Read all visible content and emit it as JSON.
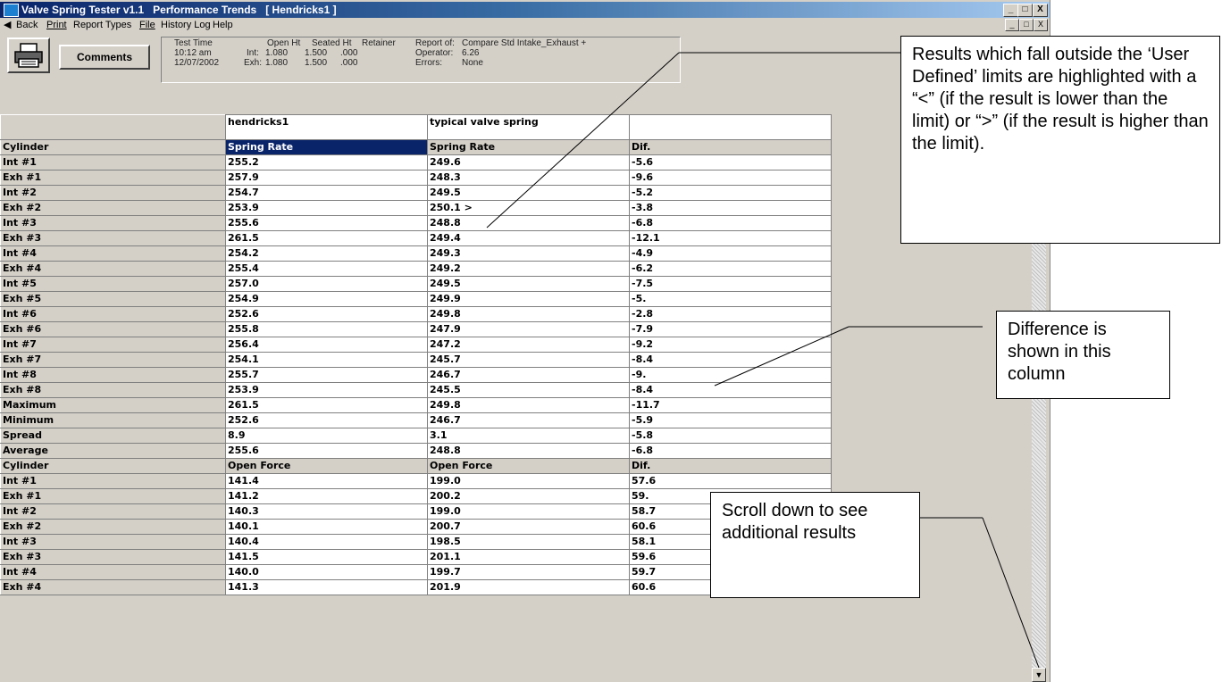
{
  "window": {
    "title": "Valve Spring Tester v1.1   Performance Trends   [ Hendricks1 ]",
    "min": "_",
    "max": "□",
    "close": "X"
  },
  "menu": {
    "back": "Back",
    "print": "Print",
    "report_types": "Report Types",
    "file": "File",
    "history_log": "History Log",
    "help": "Help"
  },
  "toolbar": {
    "comments": "Comments"
  },
  "info": {
    "test_time_label": "Test Time",
    "test_time": "10:12 am",
    "test_date": "12/07/2002",
    "int_label": "Int:",
    "exh_label": "Exh:",
    "open_ht_label": "Open Ht",
    "seated_ht_label": "Seated Ht",
    "retainer_label": "Retainer",
    "int_open": "1.080",
    "int_seated": "1.500",
    "int_retainer": ".000",
    "exh_open": "1.080",
    "exh_seated": "1.500",
    "exh_retainer": ".000",
    "report_of_label": "Report of:",
    "report_of": "Compare Std Intake_Exhaust +",
    "operator_label": "Operator:",
    "operator": "6.26",
    "errors_label": "Errors:",
    "errors": "None"
  },
  "grid": {
    "col_files": [
      "",
      "hendricks1",
      "typical valve spring",
      ""
    ],
    "rows": [
      [
        "Cylinder",
        "Spring Rate",
        "Spring Rate",
        "Dif."
      ],
      [
        "Int #1",
        "255.2",
        "249.6",
        "-5.6"
      ],
      [
        "Exh #1",
        "257.9",
        "248.3",
        "-9.6"
      ],
      [
        "Int #2",
        "254.7",
        "249.5",
        "-5.2"
      ],
      [
        "Exh #2",
        "253.9",
        "250.1 >",
        "-3.8"
      ],
      [
        "Int #3",
        "255.6",
        "248.8",
        "-6.8"
      ],
      [
        "Exh #3",
        "261.5",
        "249.4",
        "-12.1"
      ],
      [
        "Int #4",
        "254.2",
        "249.3",
        "-4.9"
      ],
      [
        "Exh #4",
        "255.4",
        "249.2",
        "-6.2"
      ],
      [
        "Int #5",
        "257.0",
        "249.5",
        "-7.5"
      ],
      [
        "Exh #5",
        "254.9",
        "249.9",
        "-5."
      ],
      [
        "Int #6",
        "252.6",
        "249.8",
        "-2.8"
      ],
      [
        "Exh #6",
        "255.8",
        "247.9",
        "-7.9"
      ],
      [
        "Int #7",
        "256.4",
        "247.2",
        "-9.2"
      ],
      [
        "Exh #7",
        "254.1",
        "245.7",
        "-8.4"
      ],
      [
        "Int #8",
        "255.7",
        "246.7",
        "-9."
      ],
      [
        "Exh #8",
        "253.9",
        "245.5",
        "-8.4"
      ],
      [
        "Maximum",
        "261.5",
        "249.8",
        "-11.7"
      ],
      [
        "Minimum",
        "252.6",
        "246.7",
        "-5.9"
      ],
      [
        "Spread",
        "8.9",
        "3.1",
        "-5.8"
      ],
      [
        "Average",
        "255.6",
        "248.8",
        "-6.8"
      ],
      [
        "Cylinder",
        "Open Force",
        "Open Force",
        "Dif."
      ],
      [
        "Int #1",
        "141.4",
        "199.0",
        "57.6"
      ],
      [
        "Exh #1",
        "141.2",
        "200.2",
        "59."
      ],
      [
        "Int #2",
        "140.3",
        "199.0",
        "58.7"
      ],
      [
        "Exh #2",
        "140.1",
        "200.7",
        "60.6"
      ],
      [
        "Int #3",
        "140.4",
        "198.5",
        "58.1"
      ],
      [
        "Exh #3",
        "141.5",
        "201.1",
        "59.6"
      ],
      [
        "Int #4",
        "140.0",
        "199.7",
        "59.7"
      ],
      [
        "Exh #4",
        "141.3",
        "201.9",
        "60.6"
      ]
    ]
  },
  "callouts": {
    "limits": "Results which fall outside the ‘User Defined’ limits are highlighted with a “<” (if the result is lower than the limit) or “>” (if the result is higher than the limit).",
    "difference": "Difference is shown in this column",
    "scroll": "Scroll down to see additional results"
  }
}
